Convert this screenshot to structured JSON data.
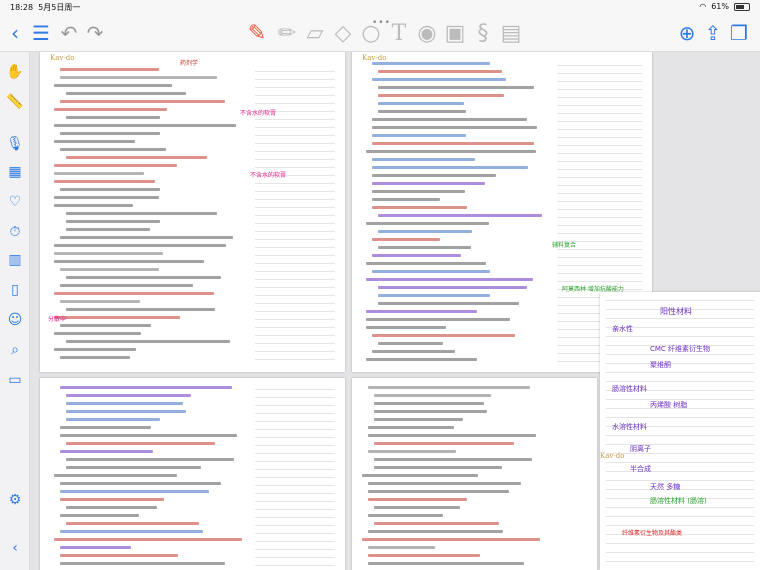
{
  "status": {
    "time": "18:28",
    "date": "5月5日周一",
    "battery": "61%"
  },
  "toolbar": {
    "dots": "•••"
  },
  "pages": {
    "left_header": "Kav-do",
    "left_title": "药剂学",
    "right_header": "Kav-do",
    "side_header": "Kav-do"
  },
  "notes": {
    "n1": "不含水的软膏",
    "n2": "不含水的软膏",
    "n3": "分散中",
    "n4": "辅料复合",
    "n5": "阿莫西林 增加抗酸能力",
    "n6": "阳性材料",
    "n7": "CMC 纤维素衍生物",
    "n8": "聚维酮",
    "n9": "肠溶性材料",
    "n10": "丙烯酸 树脂",
    "n11": "水溶性材料",
    "n12": "亲水性",
    "n13": "阴离子",
    "n14": "半合成",
    "n15": "肠溶性材料 (肠溶)",
    "n16": "天然 多糖",
    "n17": "纤维素衍生物及其酯类"
  }
}
